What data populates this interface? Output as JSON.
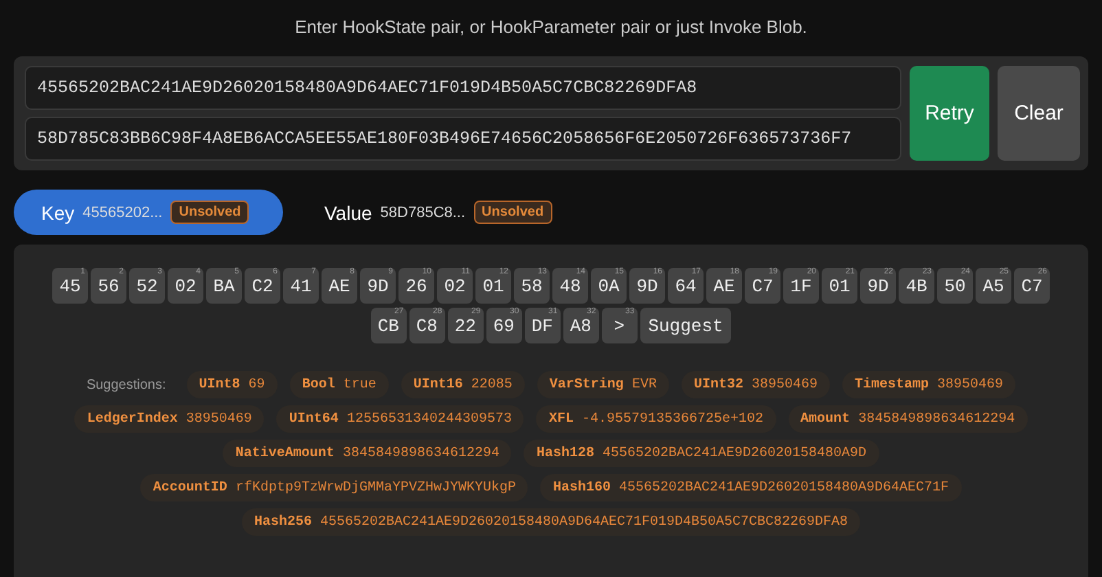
{
  "subtitle": "Enter HookState pair, or HookParameter pair or just Invoke Blob.",
  "inputs": [
    {
      "value": "45565202BAC241AE9D26020158480A9D64AEC71F019D4B50A5C7CBC82269DFA8"
    },
    {
      "value": "58D785C83BB6C98F4A8EB6ACCA5EE55AE180F03B496E74656C2058656F6E2050726F636573736F7"
    }
  ],
  "buttons": [
    {
      "label": "Retry",
      "kind": "primary"
    },
    {
      "label": "Clear",
      "kind": "secondary"
    }
  ],
  "tabs": [
    {
      "label": "Key",
      "preview": "45565202...",
      "status": "Unsolved",
      "selected": true
    },
    {
      "label": "Value",
      "preview": "58D785C8...",
      "status": "Unsolved",
      "selected": false
    }
  ],
  "bytes": [
    {
      "value": "45",
      "index": "1"
    },
    {
      "value": "56",
      "index": "2"
    },
    {
      "value": "52",
      "index": "3"
    },
    {
      "value": "02",
      "index": "4"
    },
    {
      "value": "BA",
      "index": "5"
    },
    {
      "value": "C2",
      "index": "6"
    },
    {
      "value": "41",
      "index": "7"
    },
    {
      "value": "AE",
      "index": "8"
    },
    {
      "value": "9D",
      "index": "9"
    },
    {
      "value": "26",
      "index": "10"
    },
    {
      "value": "02",
      "index": "11"
    },
    {
      "value": "01",
      "index": "12"
    },
    {
      "value": "58",
      "index": "13"
    },
    {
      "value": "48",
      "index": "14"
    },
    {
      "value": "0A",
      "index": "15"
    },
    {
      "value": "9D",
      "index": "16"
    },
    {
      "value": "64",
      "index": "17"
    },
    {
      "value": "AE",
      "index": "18"
    },
    {
      "value": "C7",
      "index": "19"
    },
    {
      "value": "1F",
      "index": "20"
    },
    {
      "value": "01",
      "index": "21"
    },
    {
      "value": "9D",
      "index": "22"
    },
    {
      "value": "4B",
      "index": "23"
    },
    {
      "value": "50",
      "index": "24"
    },
    {
      "value": "A5",
      "index": "25"
    },
    {
      "value": "C7",
      "index": "26"
    },
    {
      "value": "CB",
      "index": "27"
    },
    {
      "value": "C8",
      "index": "28"
    },
    {
      "value": "22",
      "index": "29"
    },
    {
      "value": "69",
      "index": "30"
    },
    {
      "value": "DF",
      "index": "31"
    },
    {
      "value": "A8",
      "index": "32"
    }
  ],
  "next_button": {
    "label": ">",
    "index": "33"
  },
  "suggest_button": {
    "label": "Suggest"
  },
  "suggestions_label": "Suggestions:",
  "suggestion_rows": [
    {
      "items": [
        {
          "type": "UInt8",
          "value": "69"
        },
        {
          "type": "Bool",
          "value": "true"
        },
        {
          "type": "UInt16",
          "value": "22085"
        },
        {
          "type": "VarString",
          "value": "EVR"
        },
        {
          "type": "UInt32",
          "value": "38950469"
        },
        {
          "type": "Timestamp",
          "value": "38950469"
        }
      ]
    },
    {
      "items": [
        {
          "type": "LedgerIndex",
          "value": "38950469"
        },
        {
          "type": "UInt64",
          "value": "12556531340244309573"
        },
        {
          "type": "XFL",
          "value": "-4.95579135366725e+102"
        },
        {
          "type": "Amount",
          "value": "3845849898634612294"
        }
      ]
    },
    {
      "items": [
        {
          "type": "NativeAmount",
          "value": "3845849898634612294"
        },
        {
          "type": "Hash128",
          "value": "45565202BAC241AE9D26020158480A9D"
        }
      ]
    },
    {
      "items": [
        {
          "type": "AccountID",
          "value": "rfKdptp9TzWrwDjGMMaYPVZHwJYWKYUkgP"
        },
        {
          "type": "Hash160",
          "value": "45565202BAC241AE9D26020158480A9D64AEC71F"
        }
      ]
    },
    {
      "items": [
        {
          "type": "Hash256",
          "value": "45565202BAC241AE9D26020158480A9D64AEC71F019D4B50A5C7CBC82269DFA8"
        }
      ]
    }
  ]
}
